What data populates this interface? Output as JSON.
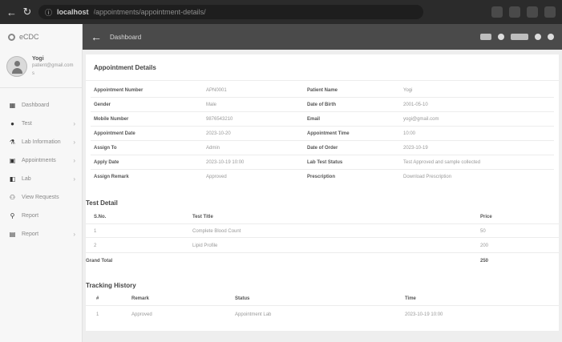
{
  "browser": {
    "url_host": "localhost",
    "url_rest": "/appointments/appointment-details/"
  },
  "sidebar": {
    "brand": "eCDC",
    "user_name": "Yogi",
    "user_sub": "patient@gmail.com",
    "user_sub2": "s",
    "items": [
      {
        "label": "Dashboard",
        "chevron": ""
      },
      {
        "label": "Test",
        "chevron": "›"
      },
      {
        "label": "Lab Information",
        "chevron": "›"
      },
      {
        "label": "Appointments",
        "chevron": "›"
      },
      {
        "label": "Lab",
        "chevron": "›"
      },
      {
        "label": "View Requests",
        "chevron": ""
      },
      {
        "label": "Report",
        "chevron": ""
      },
      {
        "label": "Report",
        "chevron": "›"
      }
    ]
  },
  "topbar": {
    "title": "Dashboard"
  },
  "appointment": {
    "title": "Appointment Details",
    "rows": [
      {
        "l1": "Appointment Number",
        "v1": "APN0001",
        "l2": "Patient Name",
        "v2": "Yogi"
      },
      {
        "l1": "Gender",
        "v1": "Male",
        "l2": "Date of Birth",
        "v2": "2001-05-10"
      },
      {
        "l1": "Mobile Number",
        "v1": "9876543210",
        "l2": "Email",
        "v2": "yogi@gmail.com"
      },
      {
        "l1": "Appointment Date",
        "v1": "2023-10-20",
        "l2": "Appointment Time",
        "v2": "10:00"
      },
      {
        "l1": "Assign To",
        "v1": "Admin",
        "l2": "Date of Order",
        "v2": "2023-10-19"
      },
      {
        "l1": "Apply Date",
        "v1": "2023-10-19 10:00",
        "l2": "Lab Test Status",
        "v2": "Test Approved and sample collected"
      },
      {
        "l1": "Assign Remark",
        "v1": "Approved",
        "l2": "Prescription",
        "v2": "Download Prescription"
      }
    ]
  },
  "tests": {
    "title": "Test Detail",
    "col_sno": "S.No.",
    "col_title": "Test Title",
    "col_price": "Price",
    "rows": [
      {
        "sno": "1",
        "title": "Complete Blood Count",
        "price": "50"
      },
      {
        "sno": "2",
        "title": "Lipid Profile",
        "price": "200"
      }
    ],
    "total_label": "Grand Total",
    "total_value": "250"
  },
  "tracking": {
    "title": "Tracking History",
    "col_no": "#",
    "col_remark": "Remark",
    "col_status": "Status",
    "col_time": "Time",
    "rows": [
      {
        "no": "1",
        "remark": "Approved",
        "status": "Appointment Lab",
        "time": "2023-10-19 10:00"
      }
    ]
  }
}
